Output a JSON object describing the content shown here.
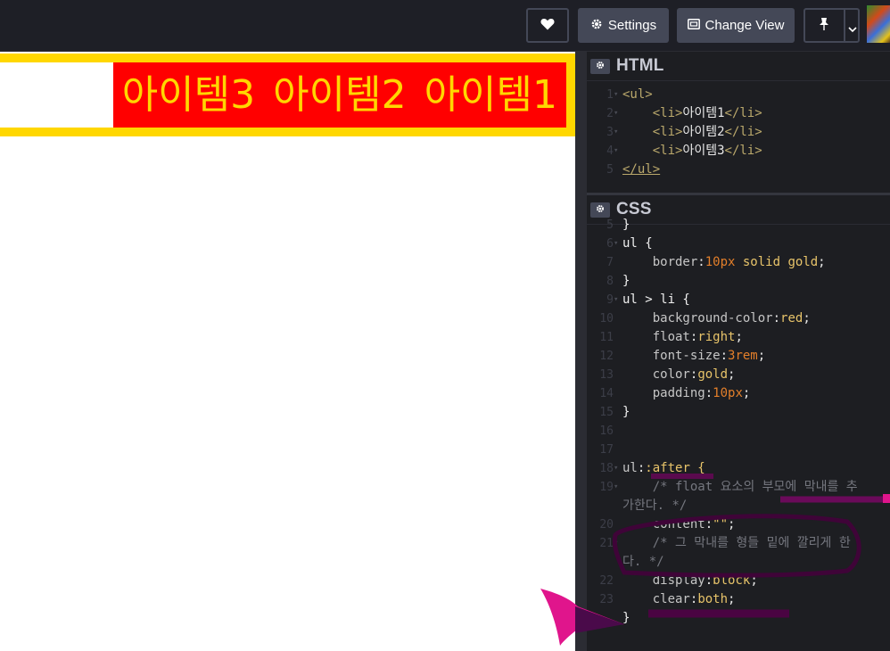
{
  "toolbar": {
    "settings_label": "Settings",
    "change_view_label": "Change View",
    "icons": [
      "heart-icon",
      "gear-icon",
      "layout-icon",
      "pin-icon",
      "chevron-down-icon"
    ]
  },
  "preview": {
    "items": [
      "아이템1",
      "아이템2",
      "아이템3"
    ]
  },
  "html_editor": {
    "title": "HTML",
    "lines": [
      {
        "n": "1",
        "fold": true,
        "indent": "",
        "open": "<ul>",
        "text": "",
        "close": ""
      },
      {
        "n": "2",
        "fold": true,
        "indent": "    ",
        "open": "<li>",
        "text": "아이템1",
        "close": "</li>"
      },
      {
        "n": "3",
        "fold": true,
        "indent": "    ",
        "open": "<li>",
        "text": "아이템2",
        "close": "</li>"
      },
      {
        "n": "4",
        "fold": true,
        "indent": "    ",
        "open": "<li>",
        "text": "아이템3",
        "close": "</li>"
      },
      {
        "n": "5",
        "fold": false,
        "indent": "",
        "open": "</ul>",
        "text": "",
        "close": ""
      }
    ]
  },
  "css_editor": {
    "title": "CSS",
    "lines": [
      {
        "n": "5",
        "code": "}"
      },
      {
        "n": "6",
        "code": "ul {"
      },
      {
        "n": "7",
        "code": "    border:10px solid gold;"
      },
      {
        "n": "8",
        "code": "}"
      },
      {
        "n": "9",
        "code": "ul > li {"
      },
      {
        "n": "10",
        "code": "    background-color:red;"
      },
      {
        "n": "11",
        "code": "    float:right;"
      },
      {
        "n": "12",
        "code": "    font-size:3rem;"
      },
      {
        "n": "13",
        "code": "    color:gold;"
      },
      {
        "n": "14",
        "code": "    padding:10px;"
      },
      {
        "n": "15",
        "code": "}"
      },
      {
        "n": "16",
        "code": ""
      },
      {
        "n": "17",
        "code": ""
      },
      {
        "n": "18",
        "code": "ul::after {"
      },
      {
        "n": "19",
        "code": "    /* float 요소의 부모에 막내를 추"
      },
      {
        "n": "",
        "code": "가한다. */"
      },
      {
        "n": "20",
        "code": "    content:\"\";"
      },
      {
        "n": "21",
        "code": "    /* 그 막내를 형들 밑에 깔리게 한"
      },
      {
        "n": "",
        "code": "다. */"
      },
      {
        "n": "22",
        "code": "    display:block;"
      },
      {
        "n": "23",
        "code": "    clear:both;"
      },
      {
        "n": "",
        "code": "}"
      }
    ]
  },
  "colors": {
    "gold": "#ffd700",
    "red": "#ff0000",
    "annotation": "#8a0a6e",
    "annotation_pink": "#e0158c"
  }
}
